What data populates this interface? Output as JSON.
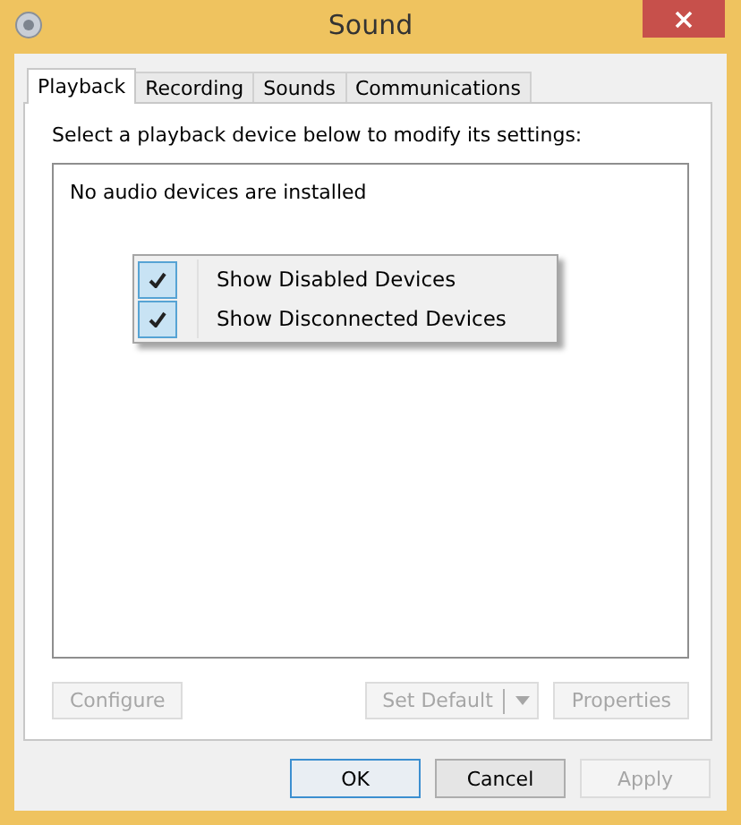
{
  "window": {
    "title": "Sound"
  },
  "tabs": [
    {
      "label": "Playback",
      "selected": true
    },
    {
      "label": "Recording",
      "selected": false
    },
    {
      "label": "Sounds",
      "selected": false
    },
    {
      "label": "Communications",
      "selected": false
    }
  ],
  "instruction": "Select a playback device below to modify its settings:",
  "device_list": {
    "message": "No audio devices are installed"
  },
  "context_menu": [
    {
      "label": "Show Disabled Devices",
      "checked": true
    },
    {
      "label": "Show Disconnected Devices",
      "checked": true
    }
  ],
  "panel_buttons": [
    {
      "label": "Configure",
      "kind": "button",
      "disabled": true
    },
    {
      "label": "Set Default",
      "kind": "split",
      "disabled": true
    },
    {
      "label": "Properties",
      "kind": "button",
      "disabled": true
    }
  ],
  "dialog_buttons": [
    {
      "label": "OK",
      "default": true,
      "disabled": false
    },
    {
      "label": "Cancel",
      "default": false,
      "disabled": false
    },
    {
      "label": "Apply",
      "default": false,
      "disabled": true
    }
  ]
}
